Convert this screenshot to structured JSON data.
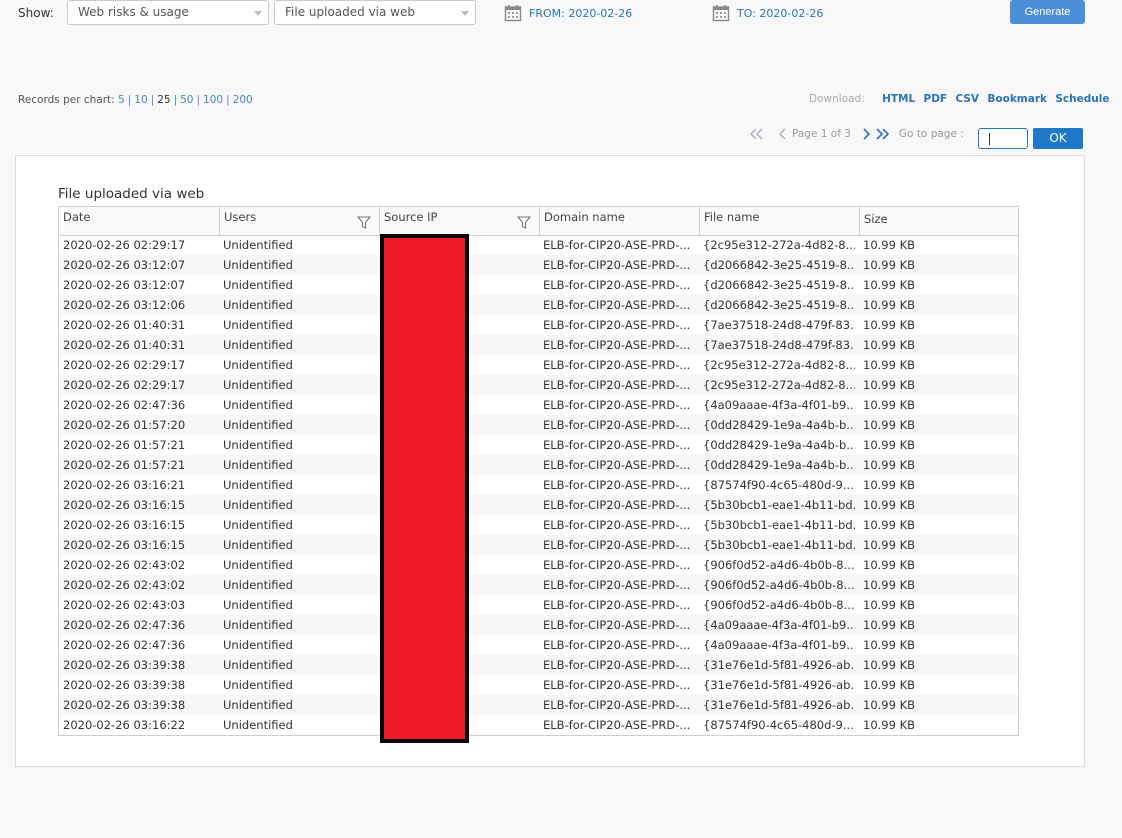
{
  "toolbar": {
    "show_label": "Show:",
    "report_select": "Web risks & usage",
    "chart_select": "File uploaded via web",
    "from_label": "FROM: 2020-02-26",
    "to_label": "TO: 2020-02-26",
    "generate_label": "Generate"
  },
  "records": {
    "label": "Records per chart:",
    "options": [
      "5",
      "10",
      "25",
      "50",
      "100",
      "200"
    ],
    "current": "25"
  },
  "download": {
    "label": "Download:",
    "links": [
      "HTML",
      "PDF",
      "CSV",
      "Bookmark",
      "Schedule"
    ]
  },
  "pager": {
    "page_label": "Page 1  of  3",
    "goto_label": "Go to page :",
    "ok_label": "OK"
  },
  "report": {
    "title": "File uploaded via web",
    "columns": [
      "Date",
      "Users",
      "Source IP",
      "Domain name",
      "File name",
      "Size"
    ],
    "rows": [
      [
        "2020-02-26 02:29:17",
        "Unidentified",
        "",
        "ELB-for-CIP20-ASE-PRD-...",
        "{2c95e312-272a-4d82-8...",
        "10.99 KB"
      ],
      [
        "2020-02-26 03:12:07",
        "Unidentified",
        "",
        "ELB-for-CIP20-ASE-PRD-...",
        "{d2066842-3e25-4519-8...",
        "10.99 KB"
      ],
      [
        "2020-02-26 03:12:07",
        "Unidentified",
        "",
        "ELB-for-CIP20-ASE-PRD-...",
        "{d2066842-3e25-4519-8...",
        "10.99 KB"
      ],
      [
        "2020-02-26 03:12:06",
        "Unidentified",
        "",
        "ELB-for-CIP20-ASE-PRD-...",
        "{d2066842-3e25-4519-8...",
        "10.99 KB"
      ],
      [
        "2020-02-26 01:40:31",
        "Unidentified",
        "",
        "ELB-for-CIP20-ASE-PRD-...",
        "{7ae37518-24d8-479f-83...",
        "10.99 KB"
      ],
      [
        "2020-02-26 01:40:31",
        "Unidentified",
        "",
        "ELB-for-CIP20-ASE-PRD-...",
        "{7ae37518-24d8-479f-83...",
        "10.99 KB"
      ],
      [
        "2020-02-26 02:29:17",
        "Unidentified",
        "",
        "ELB-for-CIP20-ASE-PRD-...",
        "{2c95e312-272a-4d82-8...",
        "10.99 KB"
      ],
      [
        "2020-02-26 02:29:17",
        "Unidentified",
        "",
        "ELB-for-CIP20-ASE-PRD-...",
        "{2c95e312-272a-4d82-8...",
        "10.99 KB"
      ],
      [
        "2020-02-26 02:47:36",
        "Unidentified",
        "",
        "ELB-for-CIP20-ASE-PRD-...",
        "{4a09aaae-4f3a-4f01-b9...",
        "10.99 KB"
      ],
      [
        "2020-02-26 01:57:20",
        "Unidentified",
        "",
        "ELB-for-CIP20-ASE-PRD-...",
        "{0dd28429-1e9a-4a4b-b...",
        "10.99 KB"
      ],
      [
        "2020-02-26 01:57:21",
        "Unidentified",
        "",
        "ELB-for-CIP20-ASE-PRD-...",
        "{0dd28429-1e9a-4a4b-b...",
        "10.99 KB"
      ],
      [
        "2020-02-26 01:57:21",
        "Unidentified",
        "",
        "ELB-for-CIP20-ASE-PRD-...",
        "{0dd28429-1e9a-4a4b-b...",
        "10.99 KB"
      ],
      [
        "2020-02-26 03:16:21",
        "Unidentified",
        "",
        "ELB-for-CIP20-ASE-PRD-...",
        "{87574f90-4c65-480d-9...",
        "10.99 KB"
      ],
      [
        "2020-02-26 03:16:15",
        "Unidentified",
        "",
        "ELB-for-CIP20-ASE-PRD-...",
        "{5b30bcb1-eae1-4b11-bd...",
        "10.99 KB"
      ],
      [
        "2020-02-26 03:16:15",
        "Unidentified",
        "",
        "ELB-for-CIP20-ASE-PRD-...",
        "{5b30bcb1-eae1-4b11-bd...",
        "10.99 KB"
      ],
      [
        "2020-02-26 03:16:15",
        "Unidentified",
        "",
        "ELB-for-CIP20-ASE-PRD-...",
        "{5b30bcb1-eae1-4b11-bd...",
        "10.99 KB"
      ],
      [
        "2020-02-26 02:43:02",
        "Unidentified",
        "",
        "ELB-for-CIP20-ASE-PRD-...",
        "{906f0d52-a4d6-4b0b-8...",
        "10.99 KB"
      ],
      [
        "2020-02-26 02:43:02",
        "Unidentified",
        "",
        "ELB-for-CIP20-ASE-PRD-...",
        "{906f0d52-a4d6-4b0b-8...",
        "10.99 KB"
      ],
      [
        "2020-02-26 02:43:03",
        "Unidentified",
        "",
        "ELB-for-CIP20-ASE-PRD-...",
        "{906f0d52-a4d6-4b0b-8...",
        "10.99 KB"
      ],
      [
        "2020-02-26 02:47:36",
        "Unidentified",
        "",
        "ELB-for-CIP20-ASE-PRD-...",
        "{4a09aaae-4f3a-4f01-b9...",
        "10.99 KB"
      ],
      [
        "2020-02-26 02:47:36",
        "Unidentified",
        "",
        "ELB-for-CIP20-ASE-PRD-...",
        "{4a09aaae-4f3a-4f01-b9...",
        "10.99 KB"
      ],
      [
        "2020-02-26 03:39:38",
        "Unidentified",
        "",
        "ELB-for-CIP20-ASE-PRD-...",
        "{31e76e1d-5f81-4926-ab...",
        "10.99 KB"
      ],
      [
        "2020-02-26 03:39:38",
        "Unidentified",
        "",
        "ELB-for-CIP20-ASE-PRD-...",
        "{31e76e1d-5f81-4926-ab...",
        "10.99 KB"
      ],
      [
        "2020-02-26 03:39:38",
        "Unidentified",
        "",
        "ELB-for-CIP20-ASE-PRD-...",
        "{31e76e1d-5f81-4926-ab...",
        "10.99 KB"
      ],
      [
        "2020-02-26 03:16:22",
        "Unidentified",
        "",
        "ELB-for-CIP20-ASE-PRD-...",
        "{87574f90-4c65-480d-9...",
        "10.99 KB"
      ]
    ]
  },
  "colors": {
    "accent": "#2a73b8",
    "button": "#4c8ed8",
    "redaction": "#ee1b24"
  },
  "icons": [
    "calendar-icon",
    "filter-icon",
    "first-page-icon",
    "prev-page-icon",
    "next-page-icon",
    "last-page-icon",
    "chevron-down-icon"
  ]
}
